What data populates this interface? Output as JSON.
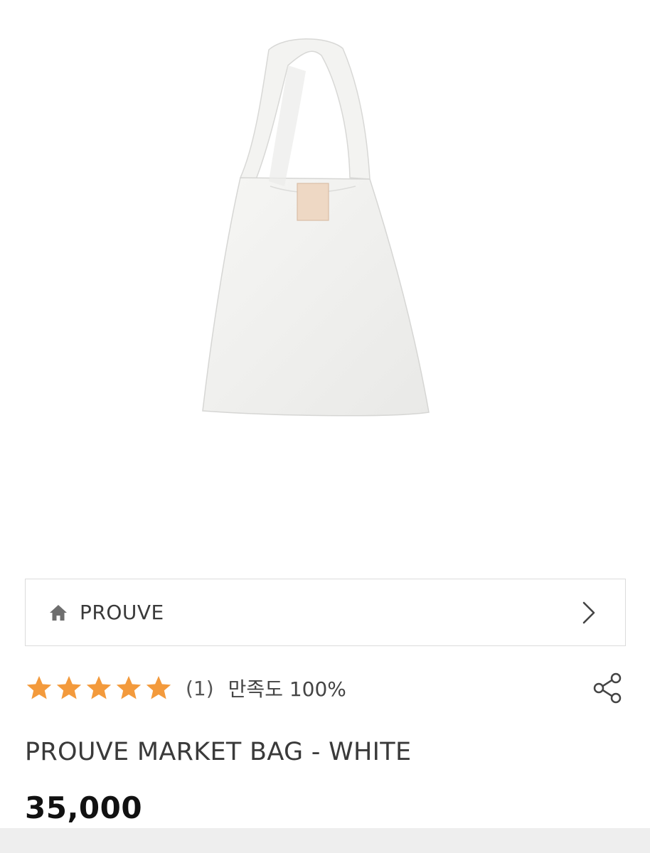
{
  "product": {
    "image_alt": "white market bag",
    "brand": "PROUVE",
    "rating_stars": 5,
    "review_count": "(1)",
    "satisfaction": "만족도 100%",
    "title": "PROUVE MARKET BAG - WHITE",
    "price": "35,000"
  },
  "icons": {
    "home": "home-icon",
    "chevron": "chevron-right-icon",
    "star": "star-icon",
    "share": "share-icon"
  },
  "colors": {
    "star": "#F39A3C",
    "border": "#DCDCDC",
    "tag": "#EED8C4"
  }
}
